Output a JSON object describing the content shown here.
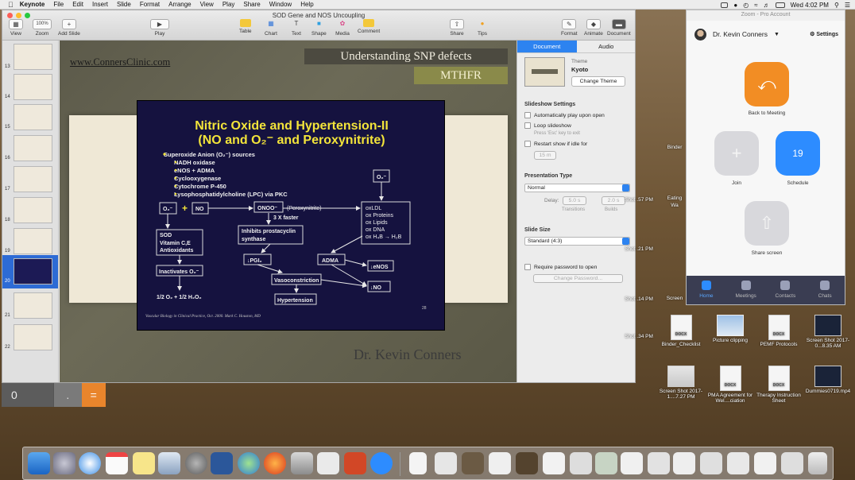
{
  "menubar": {
    "items": [
      "Keynote",
      "File",
      "Edit",
      "Insert",
      "Slide",
      "Format",
      "Arrange",
      "View",
      "Play",
      "Share",
      "Window",
      "Help"
    ],
    "clock": "Wed 4:02 PM"
  },
  "keynote": {
    "doc_title": "SOD Gene and NOS Uncoupling",
    "toolbar": {
      "view": "View",
      "zoom_value": "100%",
      "zoom": "Zoom",
      "add_slide": "Add Slide",
      "play": "Play",
      "table": "Table",
      "chart": "Chart",
      "text": "Text",
      "shape": "Shape",
      "media": "Media",
      "comment": "Comment",
      "share": "Share",
      "tips": "Tips",
      "format": "Format",
      "animate": "Animate",
      "document": "Document"
    },
    "slide_numbers": [
      "13",
      "14",
      "15",
      "16",
      "17",
      "18",
      "19",
      "20",
      "21",
      "22"
    ],
    "slide": {
      "website": "www.ConnersClinic.com",
      "heading": "Understanding SNP defects",
      "subheading": "MTHFR",
      "inner_title_1": "Nitric Oxide and Hypertension-II",
      "inner_title_2": "(NO and O₂⁻ and Peroxynitrite)",
      "bullets": [
        "Superoxide Anion (O₂⁻) sources",
        "NADH oxidase",
        "eNOS + ADMA",
        "Cyclooxygenase",
        "Cytochrome P-450",
        "Lysophosphatidylcholine (LPC) via PKC"
      ],
      "diagram": {
        "o2": "O₂⁻",
        "plus": "+",
        "no": "NO",
        "onoo": "ONOO⁻",
        "peroxynitrite": "(Peroxynitrite)",
        "faster": "3 X faster",
        "o2_top": "O₂⁻",
        "oxlist": [
          "oxLDL",
          "ox Proteins",
          "ox Lipids",
          "ox DNA",
          "ox H₄B → H₂B"
        ],
        "sod": "SOD",
        "vitamin": "Vitamin C,E",
        "antioxidants": "Antioxidants",
        "inhibits_1": "Inhibits prostacyclin",
        "inhibits_2": "synthase",
        "pgi": "↓PGI₂",
        "adma": "ADMA",
        "enos": "↓eNOS",
        "inactivates": "Inactivates O₂⁻",
        "vasoconstriction": "Vasoconstriction",
        "dno": "↓NO",
        "half": "1/2 O₂ + 1/2 H₂O₂",
        "hypertension": "Hypertension",
        "citation": "Vascular Biology in Clinical Practice, Oct. 2000. Mark C. Houston, MD",
        "page": "28"
      },
      "presenter": "Dr. Kevin Conners"
    },
    "inspector": {
      "tab_document": "Document",
      "tab_audio": "Audio",
      "theme_label": "Theme",
      "theme_name": "Kyoto",
      "change_theme": "Change Theme",
      "slideshow_settings": "Slideshow Settings",
      "auto_play": "Automatically play upon open",
      "loop": "Loop slideshow",
      "loop_hint": "Press 'Esc' key to exit",
      "restart": "Restart show if idle for",
      "restart_value": "15 m",
      "presentation_type": "Presentation Type",
      "type_value": "Normal",
      "delay": "Delay:",
      "delay_transitions": "5.0 s",
      "delay_builds": "2.0 s",
      "transitions": "Transitions",
      "builds": "Builds",
      "slide_size": "Slide Size",
      "size_value": "Standard (4:3)",
      "require_password": "Require password to open",
      "change_password": "Change Password..."
    }
  },
  "calculator": {
    "display": "0",
    "key": ".",
    "op": "="
  },
  "zoom": {
    "title": "Zoom - Pro Account",
    "user": "Dr. Kevin Conners",
    "settings": "Settings",
    "back": "Back to Meeting",
    "join": "Join",
    "schedule": "Schedule",
    "share_screen": "Share screen",
    "schedule_day": "19",
    "nav": [
      "Home",
      "Meetings",
      "Contacts",
      "Chats"
    ]
  },
  "desktop_icons": [
    {
      "label": "Binder_Checklist",
      "kind": "docx"
    },
    {
      "label": "Picture clipping",
      "kind": "ph"
    },
    {
      "label": "PEMF Protocols",
      "kind": "docx"
    },
    {
      "label": "Screen Shot 2017-0...8.35 AM",
      "kind": "sc"
    },
    {
      "label": "Screen Shot 2017-1....7.27 PM",
      "kind": "sc"
    },
    {
      "label": "PMA Agreement for Wel....ciation",
      "kind": "docx"
    },
    {
      "label": "Therapy Instruction Sheet",
      "kind": "docx"
    },
    {
      "label": "Dummies0719.mp4",
      "kind": "dk"
    }
  ],
  "desktop_fragments": [
    "Shot .34 PM",
    "Shot .14 PM",
    "Shot .21 PM",
    "Shot .57 PM",
    "Binder",
    "Screen",
    "Eating",
    "Wa"
  ]
}
